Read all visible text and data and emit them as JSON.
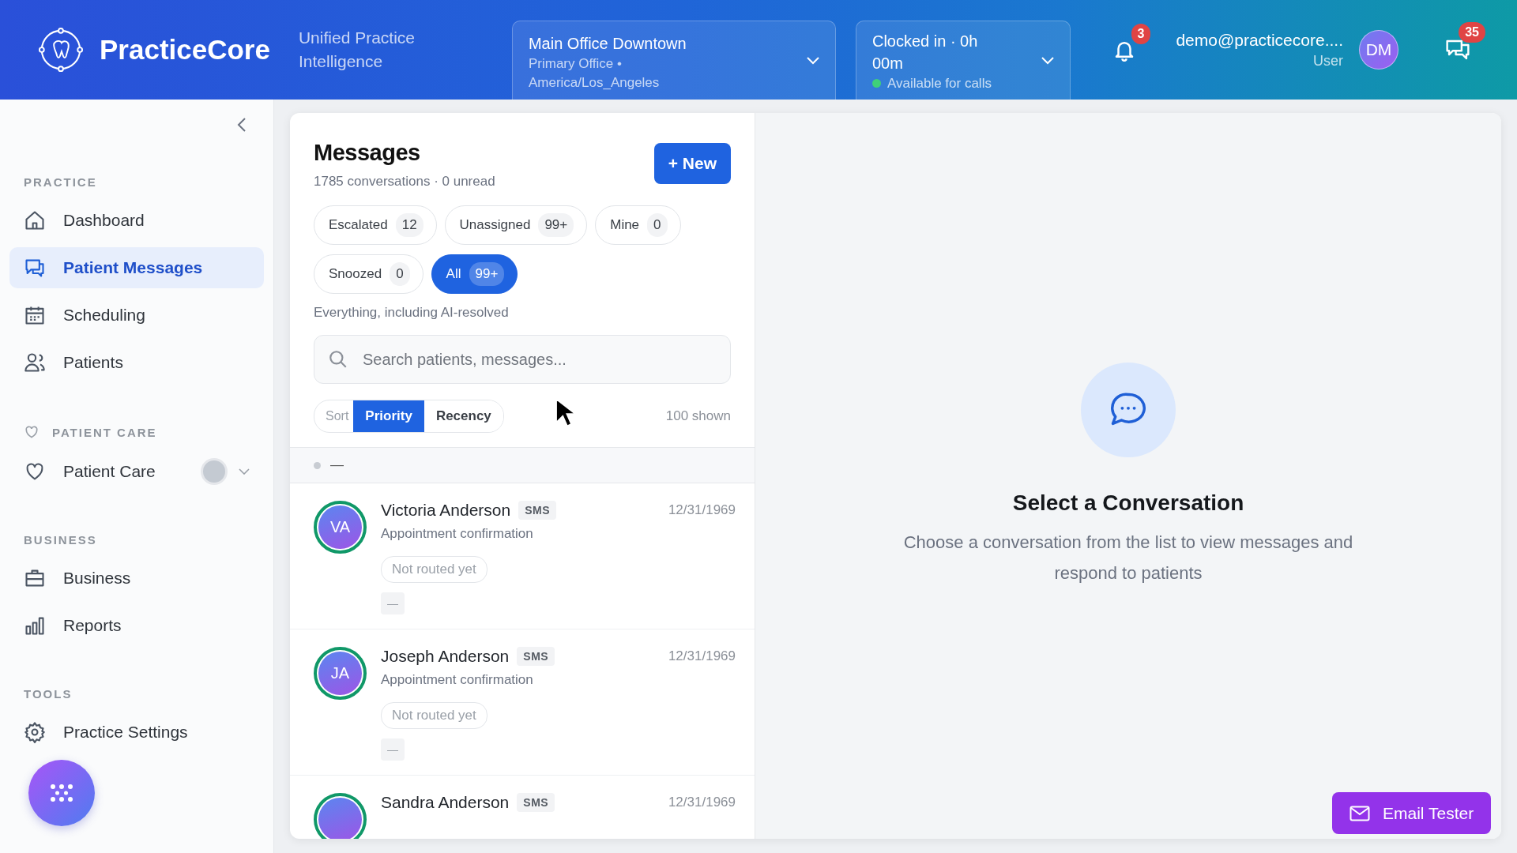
{
  "header": {
    "brand": "PracticeCore",
    "tagline": "Unified Practice Intelligence",
    "location": {
      "name": "Main Office Downtown",
      "detail": "Primary Office • America/Los_Angeles"
    },
    "clock": {
      "status": "Clocked in · 0h 00m",
      "availability": "Available for calls",
      "available": true
    },
    "notifications": {
      "count": "3"
    },
    "user": {
      "email": "demo@practicecore....",
      "role": "User",
      "initials": "DM"
    },
    "messages": {
      "count": "35"
    }
  },
  "sidebar": {
    "sections": [
      {
        "label": "PRACTICE",
        "items": [
          {
            "label": "Dashboard",
            "kind": "link",
            "selected": false
          },
          {
            "label": "Patient Messages",
            "kind": "link",
            "selected": true
          },
          {
            "label": "Scheduling",
            "kind": "link",
            "selected": false
          },
          {
            "label": "Patients",
            "kind": "link",
            "selected": false
          }
        ]
      },
      {
        "label": "PATIENT CARE",
        "items": [
          {
            "label": "Patient Care",
            "kind": "expandable",
            "selected": false,
            "expanded": false
          }
        ]
      },
      {
        "label": "BUSINESS",
        "items": [
          {
            "label": "Business",
            "kind": "link",
            "selected": false
          },
          {
            "label": "Reports",
            "kind": "link",
            "selected": false
          }
        ]
      },
      {
        "label": "TOOLS",
        "items": [
          {
            "label": "Practice Settings",
            "kind": "link",
            "selected": false
          }
        ]
      }
    ]
  },
  "inbox": {
    "title": "Messages",
    "summary": "1785 conversations · 0 unread",
    "new_button": "+ New",
    "filters": [
      {
        "label": "Escalated",
        "count": "12",
        "selected": false
      },
      {
        "label": "Unassigned",
        "count": "99+",
        "selected": false
      },
      {
        "label": "Mine",
        "count": "0",
        "selected": false
      },
      {
        "label": "Snoozed",
        "count": "0",
        "selected": false
      },
      {
        "label": "All",
        "count": "99+",
        "selected": true
      }
    ],
    "filter_caption": "Everything, including AI-resolved",
    "search": {
      "placeholder": "Search patients, messages..."
    },
    "sort": {
      "label": "Sort",
      "options": [
        {
          "label": "Priority",
          "selected": true
        },
        {
          "label": "Recency",
          "selected": false
        }
      ]
    },
    "shown": "100 shown",
    "group_header": {
      "label": "—"
    },
    "conversations": [
      {
        "initials": "VA",
        "name": "Victoria Anderson",
        "channel": "SMS",
        "date": "12/31/1969",
        "preview": "Appointment confirmation",
        "routing": "Not routed yet",
        "tag": "—"
      },
      {
        "initials": "JA",
        "name": "Joseph Anderson",
        "channel": "SMS",
        "date": "12/31/1969",
        "preview": "Appointment confirmation",
        "routing": "Not routed yet",
        "tag": "—"
      },
      {
        "name": "Sandra Anderson",
        "channel": "SMS",
        "date": "12/31/1969"
      }
    ]
  },
  "detail": {
    "title": "Select a Conversation",
    "description": "Choose a conversation from the list to view messages and respond to patients"
  },
  "email_tester": {
    "label": "Email Tester"
  }
}
